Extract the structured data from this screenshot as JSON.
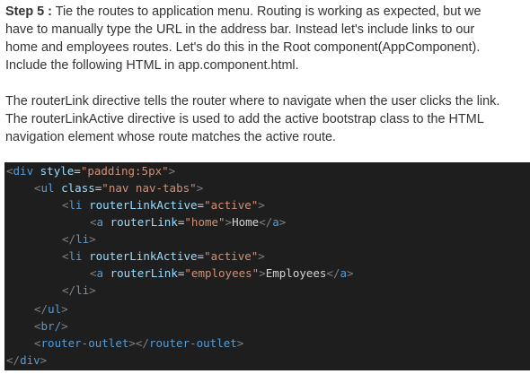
{
  "paragraph1": {
    "step_label": "Step 5 :",
    "line1_rest": " Tie the routes to application menu. Routing is working as expected, but we",
    "line2": "have to manually type the URL in the address bar. Instead let's include links to our",
    "line3": "home and employees routes. Let's do this in the Root component(AppComponent).",
    "line4": "Include the following HTML in app.component.html."
  },
  "paragraph2": {
    "line1": "The routerLink directive tells the router where to navigate when the user clicks the link.",
    "line2": "The routerLinkActive directive is used to add the active bootstrap class to the HTML",
    "line3": "navigation element whose route matches the active route."
  },
  "code": {
    "div_tag": "div",
    "style_attr": "style",
    "style_value": "\"padding:5px\"",
    "ul_tag": "ul",
    "class_attr": "class",
    "class_value": "\"nav nav-tabs\"",
    "li_tag": "li",
    "rla_attr": "routerLinkActive",
    "rla_value": "\"active\"",
    "a_tag": "a",
    "rl_attr": "routerLink",
    "rl_home_value": "\"home\"",
    "home_text": "Home",
    "rl_emp_value": "\"employees\"",
    "employees_text": "Employees",
    "br_tag": "br/",
    "router_outlet_tag": "router-outlet"
  },
  "colors": {
    "code_bg": "#1e1e1e",
    "tag": "#569cd6",
    "attr": "#9cdcfe",
    "string": "#ce9178",
    "text": "#d4d4d4",
    "bracket": "#808080",
    "body_text": "#333333"
  }
}
